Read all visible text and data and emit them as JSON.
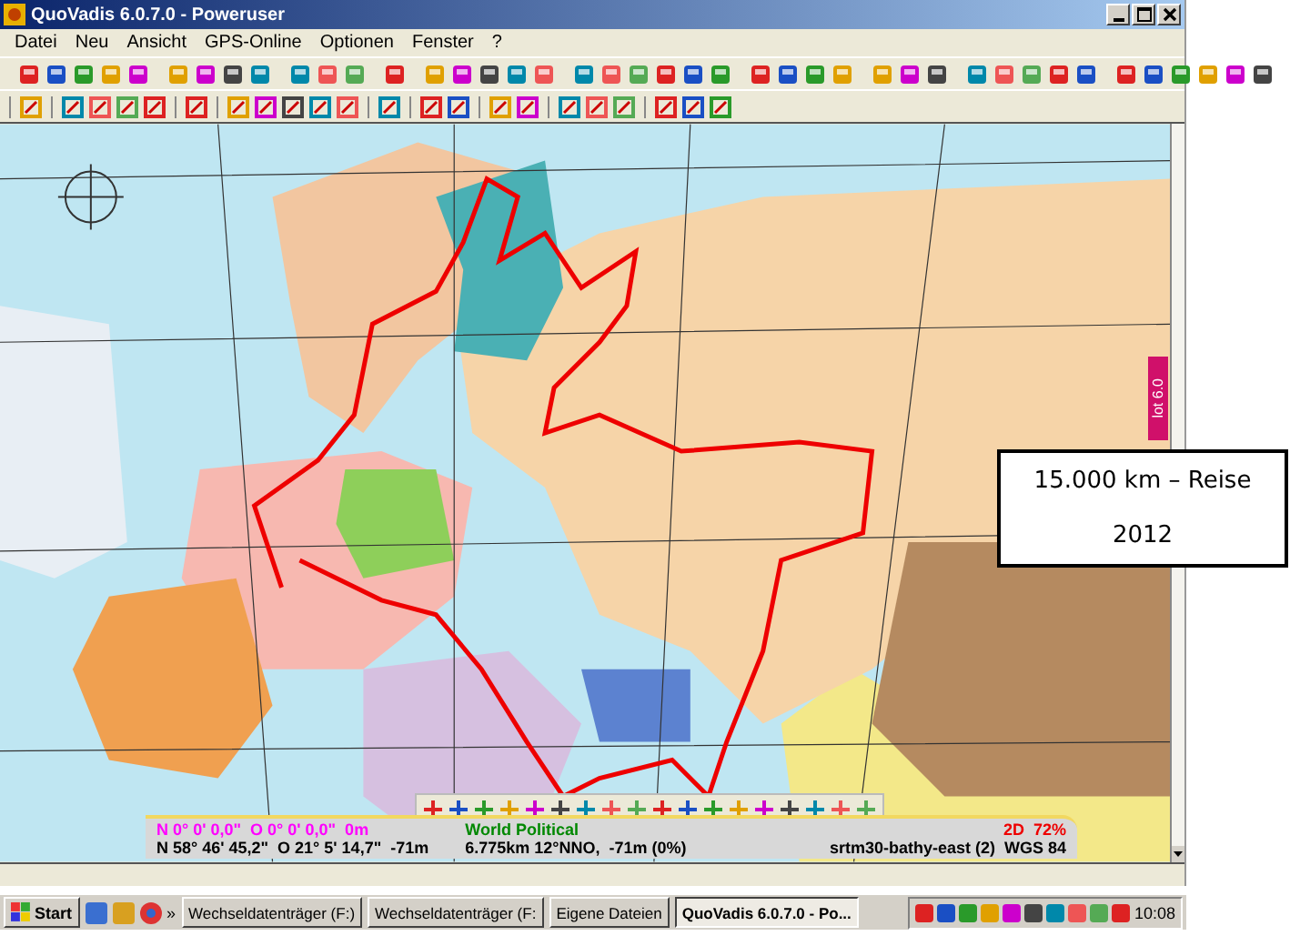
{
  "window": {
    "title": "QuoVadis 6.0.7.0 - Poweruser"
  },
  "menu": [
    "Datei",
    "Neu",
    "Ansicht",
    "GPS-Online",
    "Optionen",
    "Fenster",
    "?"
  ],
  "side_tab": {
    "label": "lot 6.0"
  },
  "note": {
    "lines": [
      "15.000 km – Reise",
      "2012"
    ]
  },
  "status": {
    "cursor_position": "N 0° 0' 0,0\"  O 0° 0' 0,0\"  0m",
    "position": "N 58° 46' 45,2\"  O 21° 5' 14,7\"  -71m",
    "map_name": "World Political",
    "distance": "6.775km 12°NNO,  -71m (0%)",
    "view_mode": "2D  72%",
    "layer": "srtm30-bathy-east (2)  WGS 84"
  },
  "taskbar": {
    "start": "Start",
    "overflow": "»",
    "tasks": [
      {
        "label": "Wechseldatenträger (F:)",
        "selected": false
      },
      {
        "label": "Wechseldatenträger (F:",
        "selected": false
      },
      {
        "label": "Eigene Dateien",
        "selected": false
      },
      {
        "label": "QuoVadis 6.0.7.0 - Po...",
        "selected": true
      }
    ],
    "clock": "10:08"
  }
}
